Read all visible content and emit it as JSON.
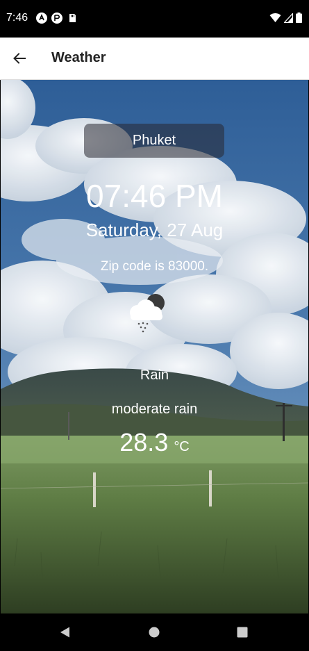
{
  "status_bar": {
    "time": "7:46"
  },
  "app_bar": {
    "title": "Weather"
  },
  "weather": {
    "city": "Phuket",
    "time": "07:46 PM",
    "date": "Saturday, 27 Aug",
    "zip": "Zip code is 83000.",
    "condition": "Rain",
    "description": "moderate rain",
    "temperature": "28.3",
    "unit": "°C",
    "icon": "cloud-rain-night-icon"
  },
  "nav_bar": {
    "back_icon": "nav-back-icon",
    "home_icon": "nav-home-icon",
    "recents_icon": "nav-recents-icon"
  }
}
